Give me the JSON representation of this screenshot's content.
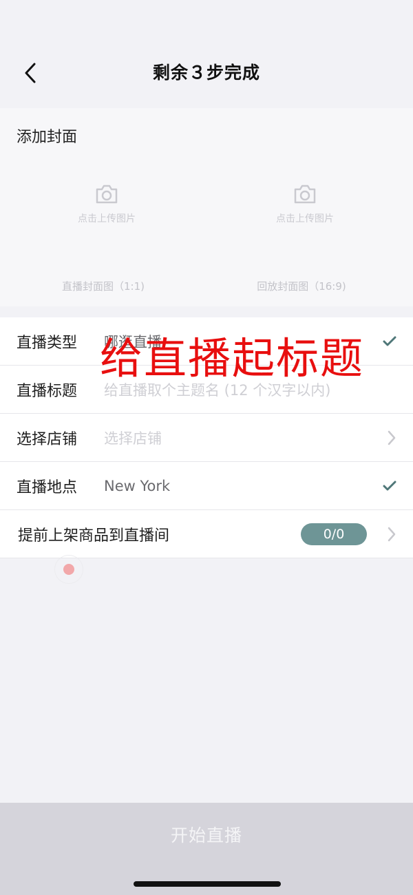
{
  "header": {
    "title": "剩余３步完成",
    "back_icon": "chevron-left-icon"
  },
  "cover": {
    "title": "添加封面",
    "uploads": [
      {
        "text": "点击上传图片",
        "caption": "直播封面图（1:1)",
        "icon": "camera-icon"
      },
      {
        "text": "点击上传图片",
        "caption": "回放封面图（16:9)",
        "icon": "camera-icon"
      }
    ]
  },
  "form": {
    "type": {
      "label": "直播类型",
      "value": "哪逛直播"
    },
    "title": {
      "label": "直播标题",
      "placeholder": "给直播取个主题名 (12 个汉字以内)"
    },
    "store": {
      "label": "选择店铺",
      "placeholder": "选择店铺"
    },
    "location": {
      "label": "直播地点",
      "value": "New York"
    },
    "products": {
      "label": "提前上架商品到直播间",
      "count": "0/0"
    }
  },
  "overlay": {
    "text": "给直播起标题"
  },
  "footer": {
    "start_label": "开始直播"
  },
  "colors": {
    "accent": "#6e9596",
    "overlay": "#e80f0f",
    "bottom_bar": "#d5d4db"
  }
}
